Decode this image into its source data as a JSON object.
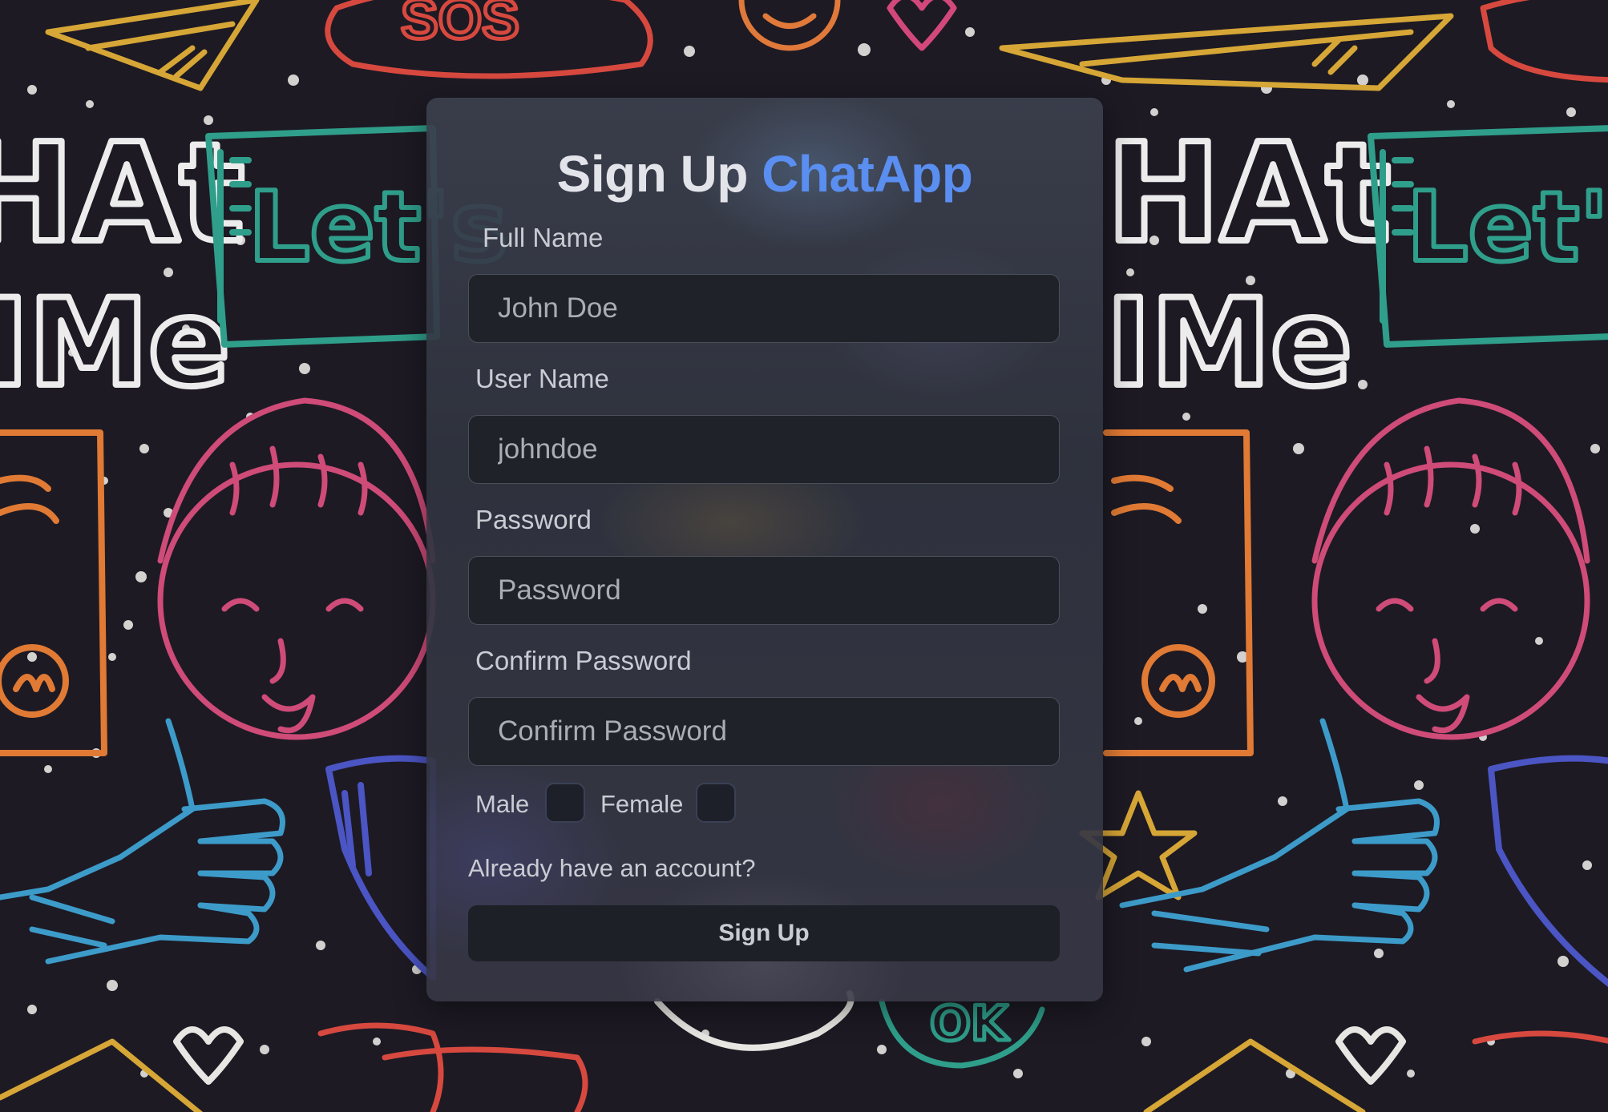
{
  "header": {
    "title_prefix": "Sign Up",
    "title_brand": "ChatApp"
  },
  "form": {
    "full_name": {
      "label": "Full Name",
      "placeholder": "John Doe",
      "value": ""
    },
    "user_name": {
      "label": "User Name",
      "placeholder": "johndoe",
      "value": ""
    },
    "password": {
      "label": "Password",
      "placeholder": "Password",
      "value": ""
    },
    "confirm_password": {
      "label": "Confirm Password",
      "placeholder": "Confirm Password",
      "value": ""
    },
    "gender": {
      "male_label": "Male",
      "female_label": "Female",
      "male_checked": false,
      "female_checked": false
    },
    "login_link": "Already have an account?",
    "submit_label": "Sign Up"
  },
  "background": {
    "doodle_texts": [
      "SOS",
      "Let's",
      "CHAT",
      "TIME",
      "OK"
    ]
  },
  "colors": {
    "brand": "#5a8ef0",
    "background": "#1d1a24",
    "input_bg": "#1f2329",
    "button_bg": "#1d2026"
  }
}
